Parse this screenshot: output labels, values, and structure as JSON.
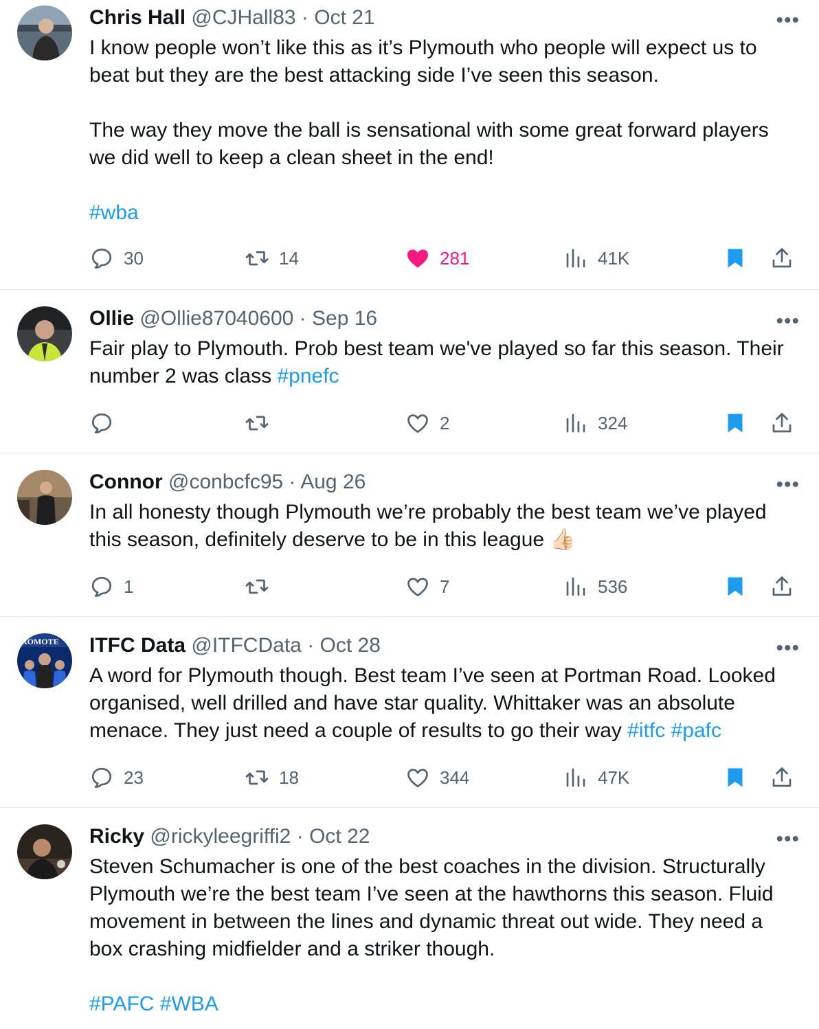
{
  "tweets": [
    {
      "name": "Chris Hall",
      "handle": "@CJHall83",
      "date": "Oct 21",
      "paragraphs": [
        "I know people won’t like this as it’s Plymouth who people will expect us to beat but they are the best attacking side I’ve seen this season.",
        "The way they move the ball is sensational with some great forward players we did well to keep a clean sheet in the end!"
      ],
      "hashtags": "#wba",
      "replies": "30",
      "retweets": "14",
      "likes": "281",
      "views": "41K"
    },
    {
      "name": "Ollie",
      "handle": "@Ollie87040600",
      "date": "Sep 16",
      "text": "Fair play to Plymouth. Prob best team we've played so far this season. Their number 2 was class",
      "tag": "#pnefc",
      "replies": "",
      "retweets": "",
      "likes": "2",
      "views": "324"
    },
    {
      "name": "Connor",
      "handle": "@conbcfc95",
      "date": "Aug 26",
      "text": "In all honesty though Plymouth we’re probably the best team we’ve played this season, definitely deserve to be in this league 👍🏻",
      "replies": "1",
      "retweets": "",
      "likes": "7",
      "views": "536"
    },
    {
      "name": "ITFC Data",
      "handle": "@ITFCData",
      "date": "Oct 28",
      "text": "A word for Plymouth though. Best team I’ve seen at Portman Road. Looked organised, well drilled and have star quality. Whittaker was an absolute menace. They just need a couple of results to go their way",
      "tag": "#itfc #pafc",
      "avatar_text": "ROMOTE",
      "replies": "23",
      "retweets": "18",
      "likes": "344",
      "views": "47K"
    },
    {
      "name": "Ricky",
      "handle": "@rickyleegriffi2",
      "date": "Oct 22",
      "text": "Steven Schumacher is one of the best coaches in the division. Structurally Plymouth we’re the best team I’ve seen at the hawthorns this season. Fluid movement in between the lines and dynamic threat out wide. They need a box crashing midfielder and a striker though.",
      "hashtags": "#PAFC #WBA"
    }
  ],
  "separator": "·",
  "more_label": "•••",
  "colors": {
    "link": "#1d9bf0",
    "like": "#f91880",
    "bookmark": "#1d9bf0",
    "muted": "#536471"
  }
}
